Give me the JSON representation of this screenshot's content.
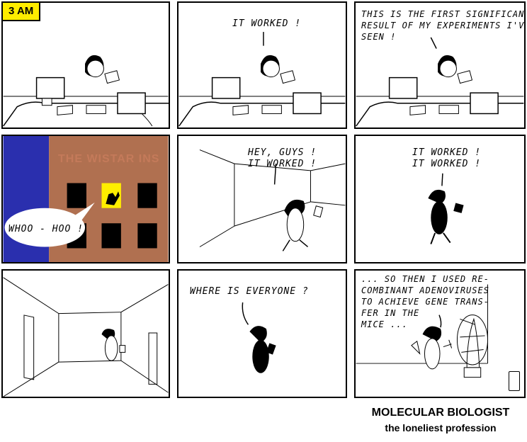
{
  "panels": {
    "p1": {
      "time_tag": "3 AM"
    },
    "p2": {
      "speech": "IT WORKED !"
    },
    "p3": {
      "speech": "THIS IS THE FIRST SIGNIFICANT\nRESULT OF MY EXPERIMENTS I'VE\nSEEN !"
    },
    "p4": {
      "building_sign": "THE WISTAR INS",
      "speech": "WHOO - HOO !"
    },
    "p5": {
      "speech": "HEY, GUYS !\nIT WORKED !"
    },
    "p6": {
      "speech": "IT WORKED !\nIT WORKED !"
    },
    "p8": {
      "speech": "WHERE IS EVERYONE ?"
    },
    "p9": {
      "speech": "... SO THEN I USED RE-\nCOMBINANT ADENOVIRUSES\nTO ACHIEVE GENE TRANS-\nFER IN THE\nMICE ..."
    }
  },
  "caption": {
    "title": "MOLECULAR BIOLOGIST",
    "subtitle": "the loneliest profession"
  },
  "colors": {
    "night_sky": "#2a2fae",
    "building": "#b07050",
    "window_lit": "#ffee00",
    "tag_bg": "#ffec00"
  }
}
